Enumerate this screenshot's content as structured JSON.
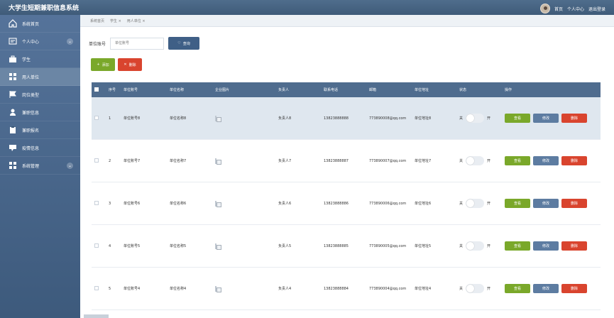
{
  "app": {
    "title": "大学生短期兼职信息系统"
  },
  "topnav": {
    "home": "首页",
    "profile": "个人中心",
    "logout": "退出登录"
  },
  "sidebar": {
    "items": [
      {
        "label": "系统首页",
        "icon": "home-icon"
      },
      {
        "label": "个人中心",
        "icon": "profile-card-icon"
      },
      {
        "label": "学生",
        "icon": "briefcase-icon"
      },
      {
        "label": "用人单位",
        "icon": "grid-icon"
      },
      {
        "label": "岗位类型",
        "icon": "flag-icon"
      },
      {
        "label": "兼职信息",
        "icon": "user-icon"
      },
      {
        "label": "兼职报名",
        "icon": "clipboard-icon"
      },
      {
        "label": "疫情信息",
        "icon": "message-icon"
      },
      {
        "label": "系统管理",
        "icon": "grid-icon"
      }
    ]
  },
  "breadcrumb": {
    "items": [
      "系统首页",
      "学生 ×",
      "用人单位 ×"
    ]
  },
  "search": {
    "label": "单位账号",
    "placeholder": "单位账号",
    "button": "查询"
  },
  "actions": {
    "add": "添加",
    "delete": "删除"
  },
  "table": {
    "headers": [
      "序号",
      "单位账号",
      "单位名称",
      "企业图片",
      "负责人",
      "联系电话",
      "邮箱",
      "单位地址",
      "状态",
      "操作"
    ],
    "status_off": "关",
    "status_on": "开",
    "ops": {
      "view": "查看",
      "edit": "修改",
      "delete": "删除"
    },
    "rows": [
      {
        "index": "1",
        "account": "单位账号8",
        "name": "单位名称8",
        "head": "负责人8",
        "phone": "13823888888",
        "email": "773890008@qq.com",
        "address": "单位地址8"
      },
      {
        "index": "2",
        "account": "单位账号7",
        "name": "单位名称7",
        "head": "负责人7",
        "phone": "13823888887",
        "email": "773890007@qq.com",
        "address": "单位地址7"
      },
      {
        "index": "3",
        "account": "单位账号6",
        "name": "单位名称6",
        "head": "负责人6",
        "phone": "13823888886",
        "email": "773890006@qq.com",
        "address": "单位地址6"
      },
      {
        "index": "4",
        "account": "单位账号5",
        "name": "单位名称5",
        "head": "负责人5",
        "phone": "13823888885",
        "email": "773890005@qq.com",
        "address": "单位地址5"
      },
      {
        "index": "5",
        "account": "单位账号4",
        "name": "单位名称4",
        "head": "负责人4",
        "phone": "13823888884",
        "email": "773890004@qq.com",
        "address": "单位地址4"
      }
    ]
  }
}
